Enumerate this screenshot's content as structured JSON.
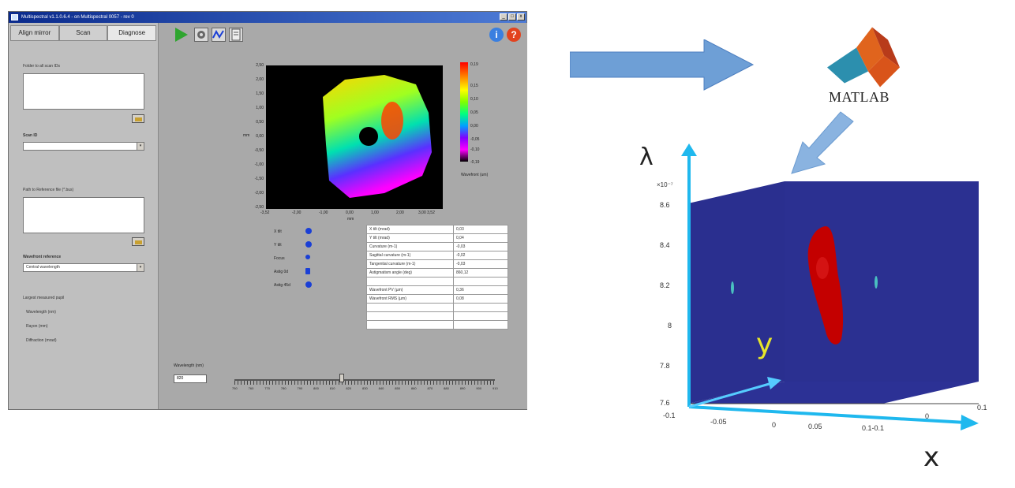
{
  "window": {
    "title": "Multispectral v1.1.0.6.4 - on Multispectral 0057 - rev 0",
    "min": "_",
    "max": "□",
    "close": "x"
  },
  "tabs": [
    "Align mirror",
    "Scan",
    "Diagnose"
  ],
  "left": {
    "folder_label": "Folder to all scan IDs",
    "scan_id_label": "Scan ID",
    "reference_label": "Path to Reference file (*.bus)",
    "wavefront_ref_label": "Wavefront reference",
    "wavefront_ref_value": "Central wavelength",
    "pupil_label": "Largest measured pupil",
    "pupil_items": [
      "Wavelength (nm)",
      "Rayon (mm)",
      "Diffraction (mrad)"
    ]
  },
  "toolbar": {
    "info": "i",
    "help": "?"
  },
  "plot2d": {
    "y_ticks": [
      "2,50",
      "2,00",
      "1,50",
      "1,00",
      "0,50",
      "0,00",
      "-0,50",
      "-1,00",
      "-1,50",
      "-2,00",
      "-2,50"
    ],
    "x_ticks": [
      "-3,52",
      "-2,00",
      "-1,00",
      "0,00",
      "1,00",
      "2,00",
      "3,00 3,52"
    ],
    "ylabel": "mm",
    "xlabel": "mm",
    "colorbar_ticks": [
      "0,19",
      "0,15",
      "0,10",
      "0,05",
      "0,00",
      "-0,05",
      "-0,10",
      "-0,19"
    ],
    "colorbar_label": "Wavefront (um)"
  },
  "indicators": [
    "X tilt",
    "Y tilt",
    "Focus",
    "Astig 0d",
    "Astig 45d"
  ],
  "table": [
    [
      "X tilt (mrad)",
      "0,03"
    ],
    [
      "Y tilt (mrad)",
      "0,04"
    ],
    [
      "Curvature (m-1)",
      "-0,03"
    ],
    [
      "Sagittal curvature (m-1)",
      "-0,02"
    ],
    [
      "Tangential curvature (m-1)",
      "-0,03"
    ],
    [
      "Astigmatism angle (deg)",
      "860,12"
    ],
    [
      "",
      ""
    ],
    [
      "Wavefront PV (µm)",
      "0,36"
    ],
    [
      "Wavefront RMS (µm)",
      "0,08"
    ],
    [
      "",
      ""
    ],
    [
      "",
      ""
    ],
    [
      "",
      ""
    ]
  ],
  "slider": {
    "label": "Wavelength (nm)",
    "value": "820",
    "ticks": [
      "750",
      "760",
      "770",
      "780",
      "790",
      "800",
      "810",
      "820",
      "830",
      "840",
      "850",
      "860",
      "870",
      "880",
      "890",
      "900",
      "910"
    ]
  },
  "matlab_logo_text": "MATLAB",
  "plot3d": {
    "axis_lambda": "λ",
    "axis_y": "y",
    "axis_x": "x",
    "scale": "×10⁻⁷",
    "z_ticks": [
      "8.6",
      "8.4",
      "8.2",
      "8",
      "7.8",
      "7.6"
    ],
    "x_ticks": [
      "-0.1",
      "-0.05",
      "0",
      "0.05",
      "0.1-0.1"
    ],
    "y_ticks": [
      "0",
      "0.1"
    ]
  },
  "colors": {
    "axis_arrow": "#1fb8ee",
    "flow_arrow": "#6e9fd6",
    "blob": "#c40000",
    "plot_bg": "#2a2f8f"
  }
}
